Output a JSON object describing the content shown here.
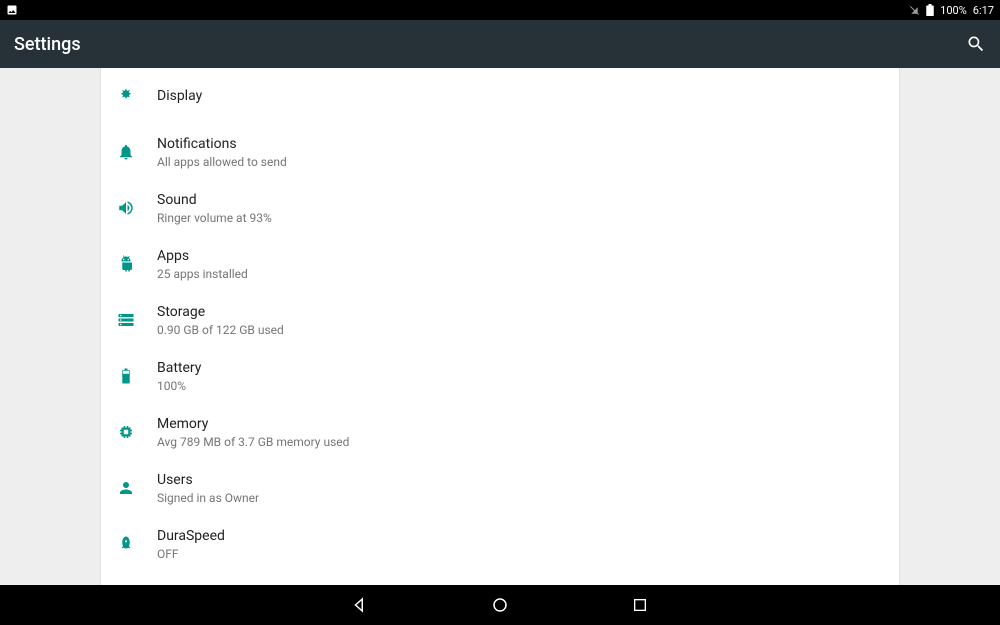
{
  "statusbar": {
    "battery": "100%",
    "time": "6:17"
  },
  "appbar": {
    "title": "Settings"
  },
  "items": [
    {
      "icon": "display",
      "title": "Display",
      "subtitle": ""
    },
    {
      "icon": "notifications",
      "title": "Notifications",
      "subtitle": "All apps allowed to send"
    },
    {
      "icon": "sound",
      "title": "Sound",
      "subtitle": "Ringer volume at 93%"
    },
    {
      "icon": "apps",
      "title": "Apps",
      "subtitle": "25 apps installed"
    },
    {
      "icon": "storage",
      "title": "Storage",
      "subtitle": "0.90 GB of 122 GB used"
    },
    {
      "icon": "battery",
      "title": "Battery",
      "subtitle": "100%"
    },
    {
      "icon": "memory",
      "title": "Memory",
      "subtitle": "Avg 789 MB of 3.7 GB memory used"
    },
    {
      "icon": "users",
      "title": "Users",
      "subtitle": "Signed in as Owner"
    },
    {
      "icon": "duraspeed",
      "title": "DuraSpeed",
      "subtitle": "OFF"
    }
  ]
}
